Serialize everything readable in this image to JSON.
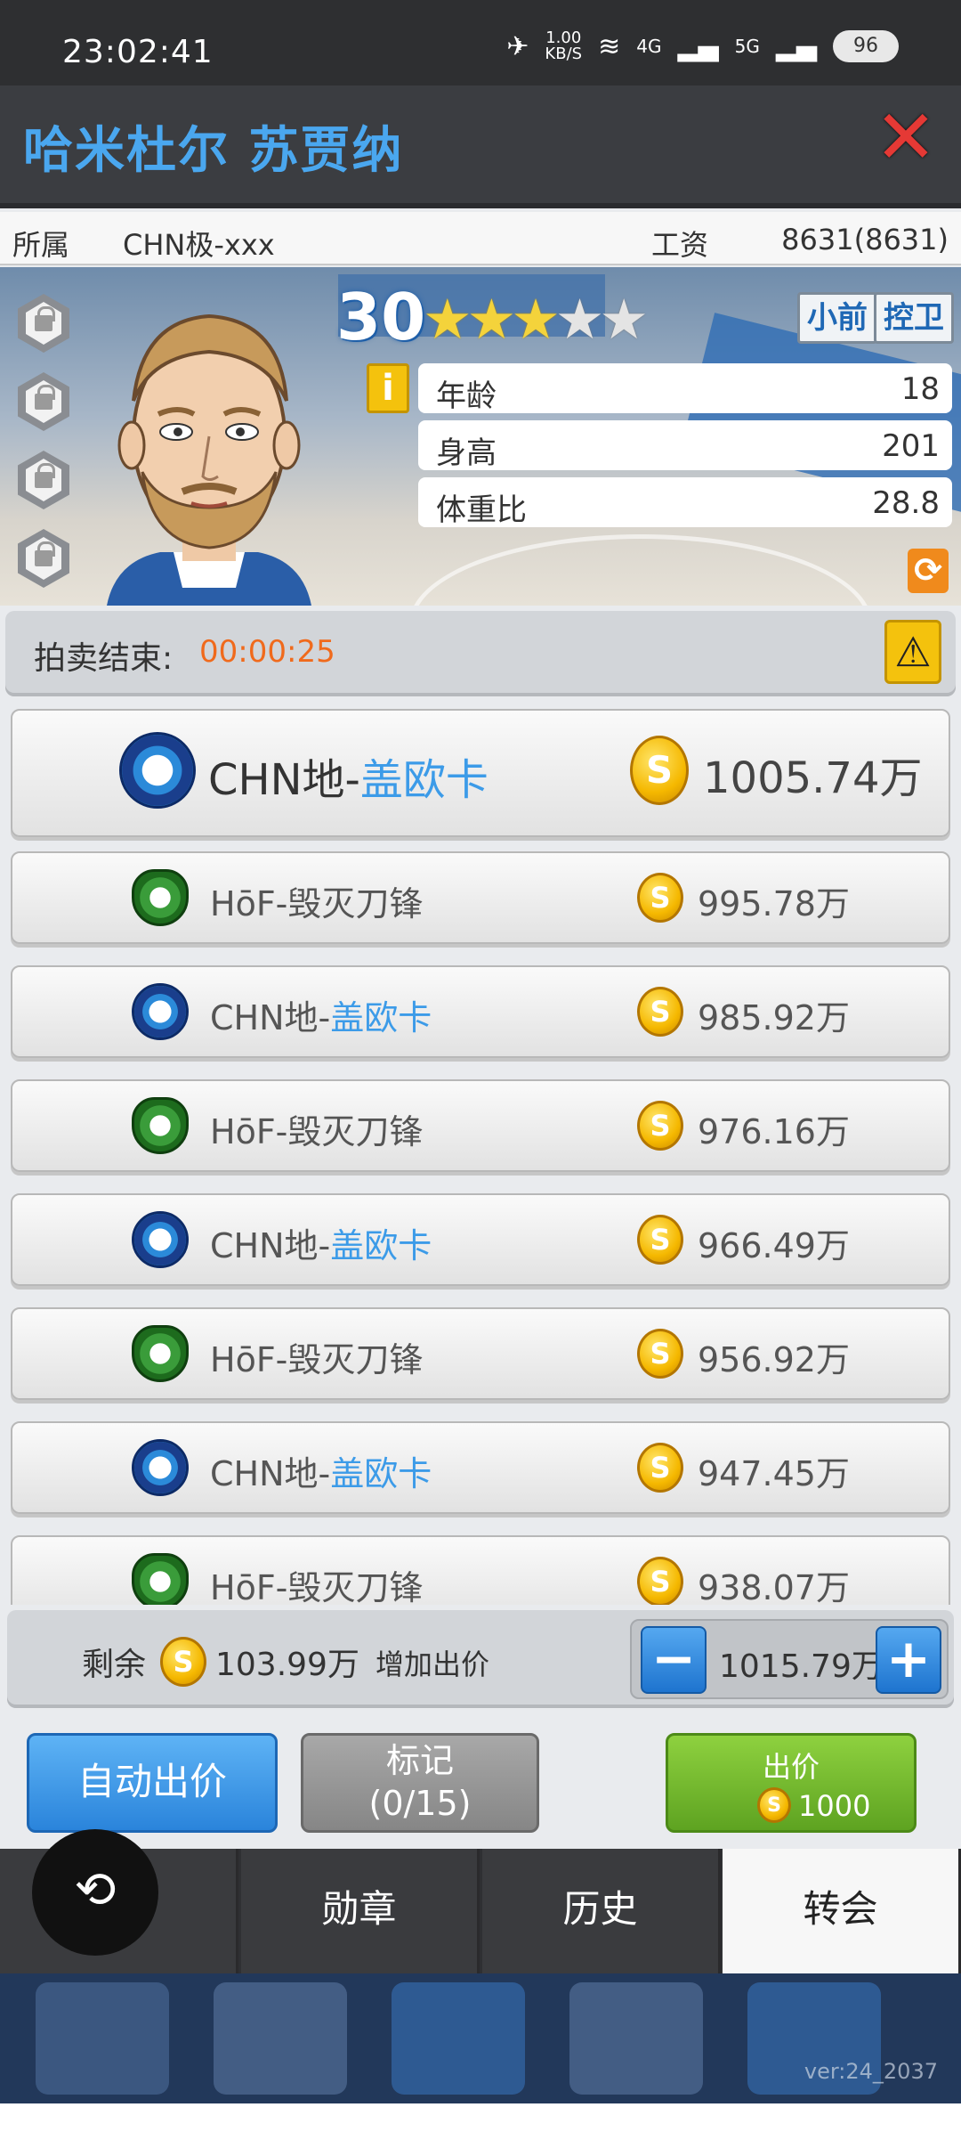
{
  "status_bar": {
    "time": "23:02:41",
    "net_speed": "1.00",
    "net_speed_unit": "KB/S",
    "signal_4g": "4G",
    "signal_5g": "5G",
    "battery": "96"
  },
  "title": {
    "player_name": "哈米杜尔 苏贾纳"
  },
  "info_row": {
    "team_label": "所属",
    "team_value": "CHN极-xxx",
    "salary_label": "工资",
    "salary_value": "8631(8631)"
  },
  "player": {
    "rating": "30",
    "stars_filled": 3,
    "stars_total": 5,
    "positions": [
      "小前",
      "控卫"
    ],
    "stats": [
      {
        "label": "年龄",
        "value": "18"
      },
      {
        "label": "身高",
        "value": "201"
      },
      {
        "label": "体重比",
        "value": "28.8"
      }
    ],
    "info_icon": "i"
  },
  "auction": {
    "label": "拍卖结束:",
    "countdown": "00:00:25"
  },
  "bids": [
    {
      "team_prefix": "CHN地-",
      "team_highlight": "盖欧卡",
      "amount": "1005.74万",
      "logo": "blue"
    },
    {
      "team_prefix": "HōF-毁灭刀锋",
      "team_highlight": "",
      "amount": "995.78万",
      "logo": "green"
    },
    {
      "team_prefix": "CHN地-",
      "team_highlight": "盖欧卡",
      "amount": "985.92万",
      "logo": "blue"
    },
    {
      "team_prefix": "HōF-毁灭刀锋",
      "team_highlight": "",
      "amount": "976.16万",
      "logo": "green"
    },
    {
      "team_prefix": "CHN地-",
      "team_highlight": "盖欧卡",
      "amount": "966.49万",
      "logo": "blue"
    },
    {
      "team_prefix": "HōF-毁灭刀锋",
      "team_highlight": "",
      "amount": "956.92万",
      "logo": "green"
    },
    {
      "team_prefix": "CHN地-",
      "team_highlight": "盖欧卡",
      "amount": "947.45万",
      "logo": "blue"
    },
    {
      "team_prefix": "HōF-毁灭刀锋",
      "team_highlight": "",
      "amount": "938.07万",
      "logo": "green"
    }
  ],
  "bid_panel": {
    "remaining_label": "剩余",
    "remaining_value": "103.99万",
    "increase_label": "增加出价",
    "bid_value": "1015.79万",
    "minus": "−",
    "plus": "+"
  },
  "actions": {
    "auto_bid": "自动出价",
    "mark_label": "标记",
    "mark_count": "(0/15)",
    "bid_label": "出价",
    "bid_cost": "1000"
  },
  "tabs": [
    {
      "label": "",
      "active": false
    },
    {
      "label": "勋章",
      "active": false
    },
    {
      "label": "历史",
      "active": false
    },
    {
      "label": "转会",
      "active": true
    }
  ],
  "bottom_nav": {
    "version": "ver:24_2037"
  },
  "colors": {
    "accent_blue": "#4aa7ef",
    "countdown_orange": "#f06a1c",
    "bid_green": "#6ab82b",
    "coin_gold": "#f5b800"
  }
}
